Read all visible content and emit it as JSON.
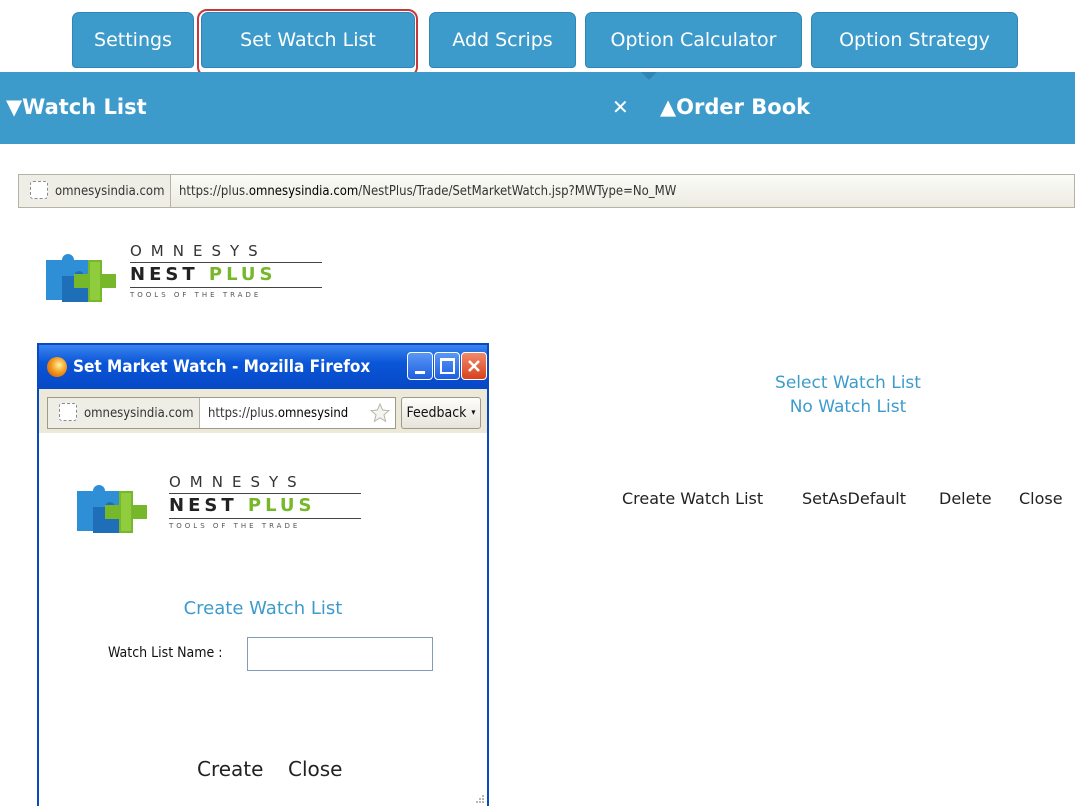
{
  "tabs": [
    "Settings",
    "Set Watch List",
    "Add Scrips",
    "Option Calculator",
    "Option Strategy"
  ],
  "bar": {
    "watch_list": "▼Watch List",
    "close_symbol": "✕",
    "order_book": "▲Order Book"
  },
  "browser": {
    "site": "omnesysindia.com",
    "url_prefix": "https://plus.",
    "url_domain": "omnesysindia.com",
    "url_suffix": "/NestPlus/Trade/SetMarketWatch.jsp?MWType=No_MW"
  },
  "logo": {
    "line1": "OMNESYS",
    "line2a": "NEST ",
    "line2b": "PLUS",
    "line3": "TOOLS OF THE TRADE"
  },
  "main": {
    "select_title": "Select Watch List",
    "no_watch_list": "No Watch List",
    "actions": [
      "Create Watch List",
      "SetAsDefault",
      "Delete",
      "Close"
    ]
  },
  "popup": {
    "title": "Set Market Watch - Mozilla Firefox",
    "site": "omnesysindia.com",
    "url_prefix": "https://plus.",
    "url_domain": "omnesysind",
    "feedback": "Feedback",
    "heading": "Create Watch List",
    "field_label": "Watch List Name :",
    "field_value": "",
    "create": "Create",
    "close": "Close"
  },
  "colors": {
    "accent": "#3d9bcc",
    "highlight": "#c8383a",
    "window_frame": "#0a49c2"
  }
}
